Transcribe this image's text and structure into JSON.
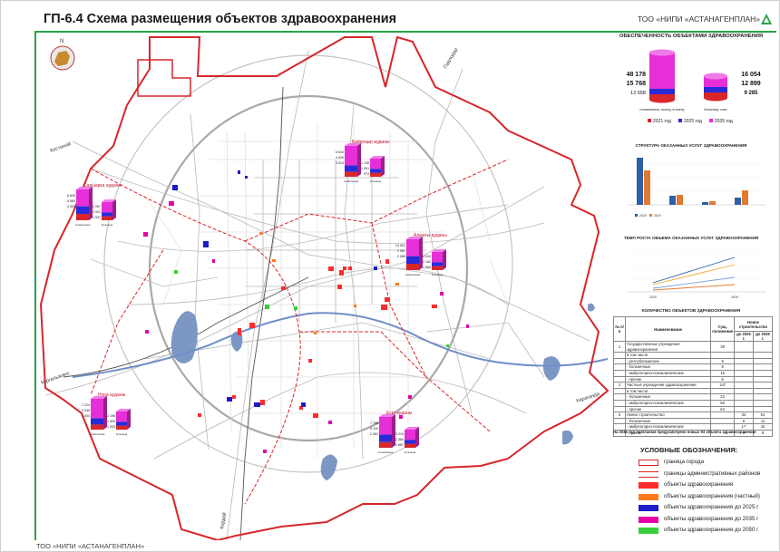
{
  "header": {
    "title": "ГП-6.4 Схема размещения объектов здравоохранения",
    "organization": "ТОО «НИПИ «АСТАНАГЕНПЛАН»"
  },
  "footer": {
    "text": "ТОО «НИПИ «АСТАНАГЕНПЛАН»"
  },
  "map": {
    "compass": "N",
    "road_labels": [
      "Костанай",
      "Павлодар",
      "Караганда",
      "Кургальжино",
      "Кордай"
    ],
    "districts": [
      {
        "name": "Сарыарка ауданы",
        "col1": [
          "6 839",
          "5 683",
          "4 303"
        ],
        "col2": [
          "2 267",
          "2 001",
          "1 537"
        ]
      },
      {
        "name": "Байқоңыр ауданы",
        "col1": [
          "6 610",
          "4 920",
          "3 913"
        ],
        "col2": [
          "1 138",
          "1 091",
          "974"
        ]
      },
      {
        "name": "Алматы ауданы",
        "col1": [
          "14 501",
          "2 987",
          "2 085"
        ],
        "col2": [
          "4 010",
          "2 162",
          "1 500"
        ]
      },
      {
        "name": "Нұра ауданы",
        "col1": [
          "7 224",
          "2 040",
          "1 004"
        ],
        "col2": [
          "2 196",
          "1 600",
          "1 203"
        ]
      },
      {
        "name": "Есіл ауданы",
        "col1": [
          "7 766",
          "5 120",
          "2 081"
        ],
        "col2": [
          "3 219",
          "2 384",
          "1 887"
        ]
      }
    ],
    "mini_chart_captions": [
      "поликлиника",
      "больница"
    ]
  },
  "provision": {
    "title": "ОБЕСПЕЧЕННОСТЬ ОБЪЕКТАМИ ЗДРАВООХРАНЕНИЯ",
    "left_values": [
      "48 178",
      "15 768",
      "12 658"
    ],
    "left_caption": "поликлиника, посещ. в смену",
    "right_values": [
      "16 054",
      "12 899",
      "9 285"
    ],
    "right_caption": "больница, коек",
    "legend": [
      "2021 год",
      "2025 год",
      "2035 год"
    ]
  },
  "structure": {
    "title": "СТРУКТУРА ОКАЗАННЫХ УСЛУГ ЗДРАВООХРАНЕНИЯ",
    "legend": [
      "2020",
      "2019"
    ]
  },
  "growth": {
    "title": "ТЕМП РОСТА ОБЪЕМА ОКАЗАННЫХ УСЛУГ ЗДРАВООХРАНЕНИЯ",
    "x_ticks": [
      "2020",
      "2019"
    ]
  },
  "count_table": {
    "title": "КОЛИЧЕСТВО ОБЪЕКТОВ ЗДРАВООХРАНЕНИЯ",
    "headers": [
      "№ п/п",
      "Наименование",
      "Сущ. положение",
      "Новое строительство",
      "до 2025 г.",
      "до 2035 г."
    ],
    "rows": [
      [
        "1",
        "Государственные учреждения здравоохранения",
        "39",
        "",
        ""
      ],
      [
        "",
        "в том числе:",
        "",
        "",
        ""
      ],
      [
        "",
        "- республиканские",
        "9",
        "",
        ""
      ],
      [
        "",
        "- больничные",
        "8",
        "",
        ""
      ],
      [
        "",
        "- амбулаторно-поликлинические",
        "16",
        "",
        ""
      ],
      [
        "",
        "- прочие",
        "6",
        "",
        ""
      ],
      [
        "2",
        "Частные учреждения здравоохранения",
        "147",
        "",
        ""
      ],
      [
        "",
        "в том числе:",
        "",
        "",
        ""
      ],
      [
        "",
        "- больничные",
        "22",
        "",
        ""
      ],
      [
        "",
        "- амбулаторно-поликлинические",
        "55",
        "",
        ""
      ],
      [
        "",
        "- прочие",
        "64",
        "",
        ""
      ],
      [
        "3",
        "Новое строительство",
        "",
        "32",
        "61"
      ],
      [
        "",
        "- больничные",
        "",
        "6",
        "11"
      ],
      [
        "",
        "- амбулаторно-поликлинические",
        "",
        "17",
        "42"
      ],
      [
        "",
        "- прочие",
        "",
        "9",
        "8"
      ]
    ],
    "note": "На 2035 год генпланом предусмотрено новых 93 объекта здравоохранения"
  },
  "legend": {
    "title": "УСЛОВНЫЕ ОБОЗНАЧЕНИЯ:",
    "items": [
      {
        "label": "граница города",
        "kind": "city-border",
        "color": "#d8262a"
      },
      {
        "label": "границы административных районов",
        "kind": "district-border",
        "color": "#d8262a"
      },
      {
        "label": "объекты здравоохранения",
        "kind": "fill",
        "color": "#ff2b2b"
      },
      {
        "label": "объекты здравоохранения (частный)",
        "kind": "fill",
        "color": "#ff7a1a"
      },
      {
        "label": "объекты здравоохранения до 2025 г",
        "kind": "fill",
        "color": "#1c1cc8"
      },
      {
        "label": "объекты здравоохранения до 2035 г",
        "kind": "fill",
        "color": "#e600a8"
      },
      {
        "label": "объекты здравоохранения до 2050 г",
        "kind": "fill",
        "color": "#3ccf3c"
      }
    ]
  },
  "colors": {
    "c2021": "#d8262a",
    "c2025": "#2a2ad8",
    "c2035": "#e62fd6",
    "accent": "#2aa24a"
  }
}
